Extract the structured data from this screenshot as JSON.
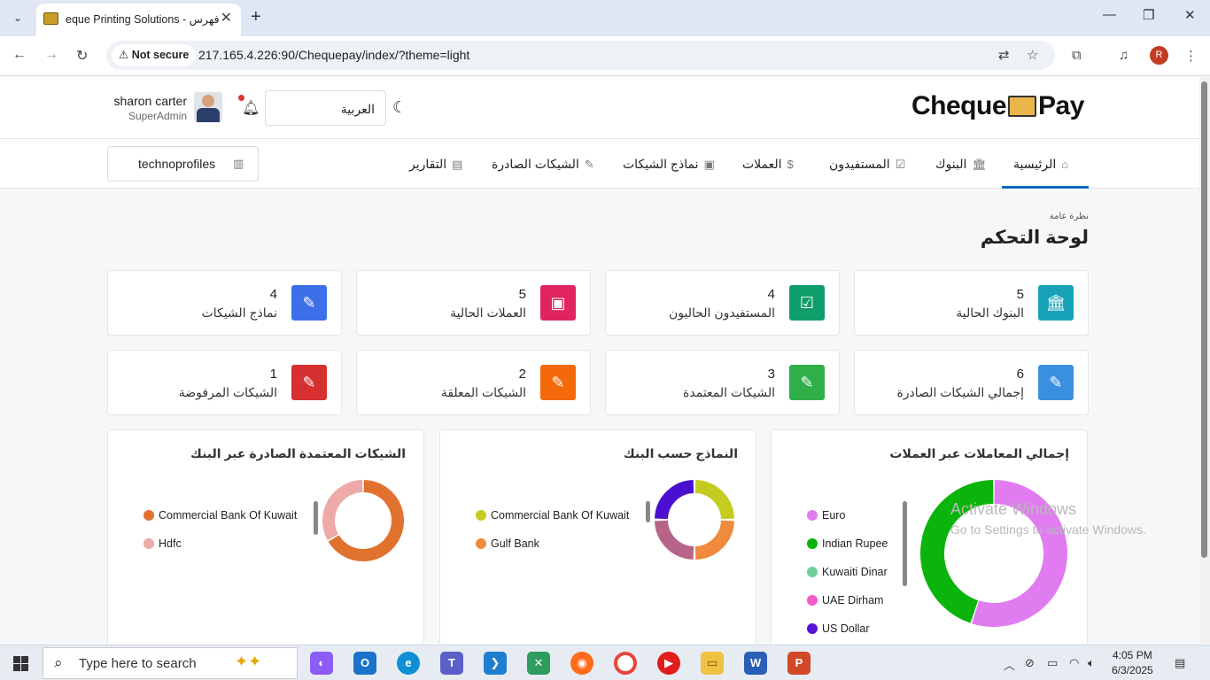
{
  "browser": {
    "tab_title": "eque Printing Solutions - فهرس",
    "tab_close": "✕",
    "new_tab": "+",
    "not_secure": "Not secure",
    "url": "217.165.4.226:90/Chequepay/index/?theme=light",
    "profile_initial": "R"
  },
  "header": {
    "logo_left": "Cheque",
    "logo_right": "Pay",
    "user_name": "sharon carter",
    "user_role": "SuperAdmin",
    "language": "العربية"
  },
  "menu": {
    "items": [
      {
        "label": "الرئيسية",
        "icon": "home-icon"
      },
      {
        "label": "البنوك",
        "icon": "bank-icon"
      },
      {
        "label": "المستفيدون",
        "icon": "check-square-icon"
      },
      {
        "label": "العملات",
        "icon": "dollar-icon"
      },
      {
        "label": "نماذج الشيكات",
        "icon": "cash-icon"
      },
      {
        "label": "الشيكات الصادرة",
        "icon": "pencil-icon"
      },
      {
        "label": "التقارير",
        "icon": "report-icon"
      }
    ],
    "organization": "technoprofiles"
  },
  "page": {
    "breadcrumb": "نظرة عامة",
    "title": "لوحة التحكم"
  },
  "stats": [
    {
      "value": "5",
      "label": "البنوك الحالية",
      "color": "#17a2b8",
      "icon": "bank-icon"
    },
    {
      "value": "4",
      "label": "المستفيدون الحاليون",
      "color": "#0f9d6a",
      "icon": "check-square-icon"
    },
    {
      "value": "5",
      "label": "العملات الحالية",
      "color": "#e0245e",
      "icon": "cash-icon"
    },
    {
      "value": "4",
      "label": "نماذج الشيكات",
      "color": "#3d6fe8",
      "icon": "pencil-icon"
    },
    {
      "value": "6",
      "label": "إجمالي الشيكات الصادرة",
      "color": "#3b8fe0",
      "icon": "pencil-icon"
    },
    {
      "value": "3",
      "label": "الشيكات المعتمدة",
      "color": "#2fae4a",
      "icon": "pencil-icon"
    },
    {
      "value": "2",
      "label": "الشيكات المعلقة",
      "color": "#f46a0a",
      "icon": "pencil-icon"
    },
    {
      "value": "1",
      "label": "الشيكات المرفوضة",
      "color": "#d63031",
      "icon": "pencil-icon"
    }
  ],
  "chart_data": [
    {
      "type": "pie",
      "title": "إجمالي المعاملات عبر العملات",
      "labels": [
        "Euro",
        "Indian Rupee",
        "Kuwaiti Dinar",
        "UAE Dirham",
        "US Dollar"
      ],
      "values": [
        55,
        45,
        0,
        0,
        0
      ],
      "colors": [
        "#e07cf0",
        "#0ab40a",
        "#6fcf97",
        "#f25ac8",
        "#5a12d8"
      ]
    },
    {
      "type": "pie",
      "title": "النماذج حسب البنك",
      "labels": [
        "Commercial Bank Of Kuwait",
        "Gulf Bank"
      ],
      "values": [
        1,
        1,
        1,
        1
      ],
      "colors": [
        "#c4cd1f",
        "#f08a3c",
        "#b86488",
        "#4a10d0"
      ]
    },
    {
      "type": "pie",
      "title": "الشيكات المعتمدة الصادرة عبر البنك",
      "labels": [
        "Commercial Bank Of Kuwait",
        "Hdfc"
      ],
      "values": [
        2,
        1
      ],
      "colors": [
        "#e0712e",
        "#eeaaa8"
      ]
    }
  ],
  "watermark": {
    "line1": "Activate Windows",
    "line2": "Go to Settings to activate Windows."
  },
  "taskbar": {
    "search_placeholder": "Type here to search",
    "time": "4:05 PM",
    "date": "6/3/2025"
  }
}
